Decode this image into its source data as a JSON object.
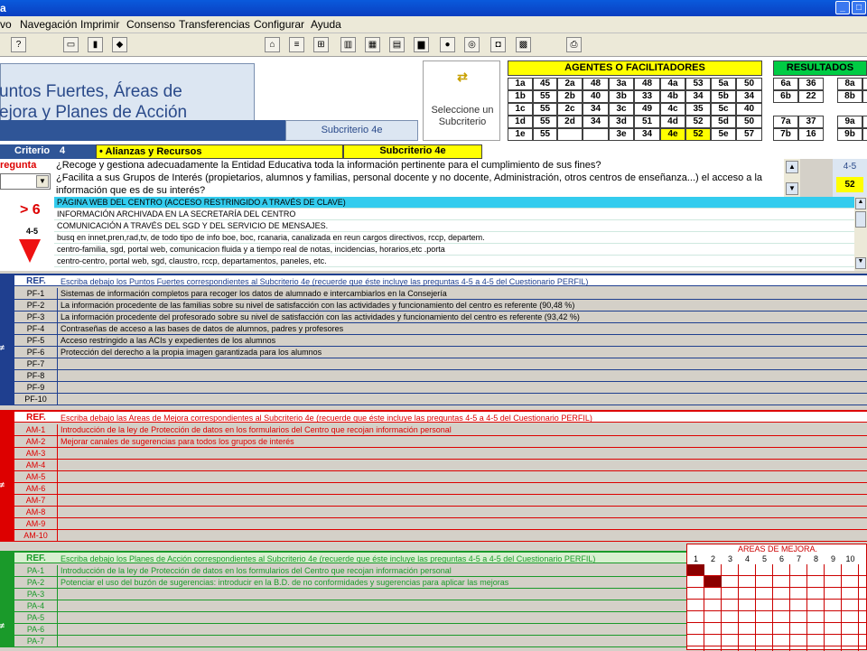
{
  "window": {
    "title": "a"
  },
  "menu": [
    "vo",
    "Navegación",
    "Imprimir",
    "Consenso",
    "Transferencias",
    "Configurar",
    "Ayuda"
  ],
  "header": {
    "title_line1": "untos Fuertes, Áreas de",
    "title_line2": "ejora y Planes de Acción",
    "subcriterio_box": "Subcriterio 4e",
    "select_label": "Seleccione un Subcriterio"
  },
  "agentes": {
    "title": "AGENTES O FACILITADORES",
    "rows": [
      [
        "1a",
        "45",
        "2a",
        "48",
        "3a",
        "48",
        "4a",
        "53",
        "5a",
        "50"
      ],
      [
        "1b",
        "55",
        "2b",
        "40",
        "3b",
        "33",
        "4b",
        "34",
        "5b",
        "34"
      ],
      [
        "1c",
        "55",
        "2c",
        "34",
        "3c",
        "49",
        "4c",
        "35",
        "5c",
        "40"
      ],
      [
        "1d",
        "55",
        "2d",
        "34",
        "3d",
        "51",
        "4d",
        "52",
        "5d",
        "50"
      ],
      [
        "1e",
        "55",
        "",
        "",
        "3e",
        "34",
        "4e",
        "52",
        "5e",
        "57"
      ]
    ]
  },
  "resultados": {
    "title": "RESULTADOS",
    "rows": [
      [
        "6a",
        "36",
        "8a",
        ""
      ],
      [
        "6b",
        "22",
        "8b",
        ""
      ],
      [
        "",
        "",
        "",
        ""
      ],
      [
        "7a",
        "37",
        "9a",
        ""
      ],
      [
        "7b",
        "16",
        "9b",
        ""
      ]
    ]
  },
  "criterio": {
    "label": "Criterio",
    "number": "4",
    "name": "• Alianzas y Recursos",
    "sub": "Subcriterio 4e"
  },
  "pregunta": {
    "label": "regunta",
    "text": [
      "¿Recoge y gestiona adecuadamente la Entidad Educativa toda la información pertinente para el cumplimiento de sus fines?",
      "¿Facilita a sus Grupos de Interés (propietarios, alumnos y familias, personal docente y no docente, Administración, otros centros de enseñanza...) el acceso a la",
      "información que es de su interés?"
    ],
    "code": "4-5",
    "score": "52"
  },
  "evidencias": {
    "indicator": "> 6",
    "code": "4-5",
    "items": [
      "PÁGINA WEB DEL CENTRO (ACCESO RESTRINGIDO A TRAVÉS DE CLAVE)",
      "INFORMACIÓN ARCHIVADA EN LA SECRETARÍA DEL CENTRO",
      "COMUNICACIÓN A TRAVÉS DEL SGD Y DEL SERVICIO DE MENSAJES.",
      "busq en innet,pren,rad,tv, de todo tipo de info boe, boc, rcanaria, canalizada en reun cargos directivos, rccp, departem.",
      "centro-familia, sgd, portal web, comunicacion fluida y a tiempo real de notas, incidencias, horarios,etc .porta",
      "centro-centro, portal web, sgd, claustro, rccp, departamentos, paneles, etc."
    ]
  },
  "puntos_fuertes": {
    "ref": "REF.",
    "header": "Escriba debajo los Puntos Fuertes correspondientes al Subcriterio 4e (recuerde que éste incluye las preguntas 4-5 a 4-5 del Cuestionario PERFIL)",
    "rows": [
      {
        "ref": "PF-1",
        "text": "Sistemas de información completos para recoger los datos de alumnado e intercambiarlos en la Consejería"
      },
      {
        "ref": "PF-2",
        "text": "La información procedente de las familias sobre su nivel de satisfacción con las actividades y funcionamiento del centro es referente (90,48 %)"
      },
      {
        "ref": "PF-3",
        "text": "La información procedente del profesorado sobre su nivel de satisfacción con las actividades y funcionamiento del centro es referente (93,42 %)"
      },
      {
        "ref": "PF-4",
        "text": "Contraseñas de acceso a las bases de datos de alumnos, padres y profesores"
      },
      {
        "ref": "PF-5",
        "text": "Acceso restringido a las ACIs y expedientes de los alumnos"
      },
      {
        "ref": "PF-6",
        "text": "Protección del derecho a la propia imagen garantizada para los alumnos"
      },
      {
        "ref": "PF-7",
        "text": ""
      },
      {
        "ref": "PF-8",
        "text": ""
      },
      {
        "ref": "PF-9",
        "text": ""
      },
      {
        "ref": "PF-10",
        "text": ""
      }
    ]
  },
  "areas_mejora": {
    "ref": "REF.",
    "header": "Escriba debajo las Areas de Mejora correspondientes al Subcriterio 4e (recuerde que éste incluye las preguntas 4-5 a 4-5 del Cuestionario PERFIL)",
    "rows": [
      {
        "ref": "AM-1",
        "text": "Introducción de la ley de Protección de datos en los formularios del Centro que recojan información personal"
      },
      {
        "ref": "AM-2",
        "text": "Mejorar canales de sugerencias para todos los grupos de interés"
      },
      {
        "ref": "AM-3",
        "text": ""
      },
      {
        "ref": "AM-4",
        "text": ""
      },
      {
        "ref": "AM-5",
        "text": ""
      },
      {
        "ref": "AM-6",
        "text": ""
      },
      {
        "ref": "AM-7",
        "text": ""
      },
      {
        "ref": "AM-8",
        "text": ""
      },
      {
        "ref": "AM-9",
        "text": ""
      },
      {
        "ref": "AM-10",
        "text": ""
      }
    ]
  },
  "planes_accion": {
    "ref": "REF.",
    "header": "Escriba debajo los Planes de Acción correspondientes al Subcriterio 4e (recuerde que éste incluye las preguntas 4-5 a 4-5 del Cuestionario PERFIL)",
    "rows": [
      {
        "ref": "PA-1",
        "text": "Introducción de la ley de Protección de datos en los formularios del Centro que recojan información personal"
      },
      {
        "ref": "PA-2",
        "text": "Potenciar el uso del buzón de sugerencias: introducir en la B.D. de no conformidades y sugerencias para aplicar las mejoras"
      },
      {
        "ref": "PA-3",
        "text": ""
      },
      {
        "ref": "PA-4",
        "text": ""
      },
      {
        "ref": "PA-5",
        "text": ""
      },
      {
        "ref": "PA-6",
        "text": ""
      },
      {
        "ref": "PA-7",
        "text": ""
      }
    ]
  },
  "matriz": {
    "title": "AREAS DE MEJORA.",
    "cols": [
      "1",
      "2",
      "3",
      "4",
      "5",
      "6",
      "7",
      "8",
      "9",
      "10"
    ],
    "filled": [
      [
        0,
        0
      ],
      [
        1,
        1
      ]
    ]
  },
  "colors": {
    "blue": "#1f3f8f",
    "red": "#dd0000",
    "green": "#1a9a2a",
    "yellow": "#ffff00"
  }
}
